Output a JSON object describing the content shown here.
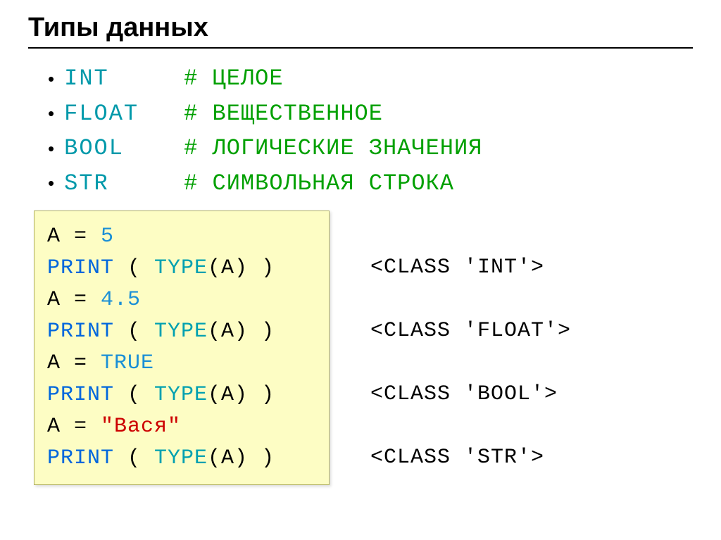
{
  "title": "Типы данных",
  "types": [
    {
      "name": "INT",
      "comment": "# ЦЕЛОЕ"
    },
    {
      "name": "FLOAT",
      "comment": "# ВЕЩЕСТВЕННОЕ"
    },
    {
      "name": "BOOL",
      "comment": "# ЛОГИЧЕСКИЕ ЗНАЧЕНИЯ"
    },
    {
      "name": "STR",
      "comment": "# СИМВОЛЬНАЯ СТРОКА"
    }
  ],
  "code": {
    "a1_lhs": "A",
    "a1_eq": " = ",
    "a1_val": "5",
    "p_lhs": "PRINT",
    "p_open": " ( ",
    "type_kw": "TYPE",
    "p_inner": "(A)",
    "p_close": " )",
    "a2_val": "4.5",
    "a3_val": "TRUE",
    "a4_val": "\"Вася\""
  },
  "output": {
    "o1": "<CLASS 'INT'>",
    "o2": "<CLASS 'FLOAT'>",
    "o3": "<CLASS 'BOOL'>",
    "o4": "<CLASS 'STR'>"
  }
}
